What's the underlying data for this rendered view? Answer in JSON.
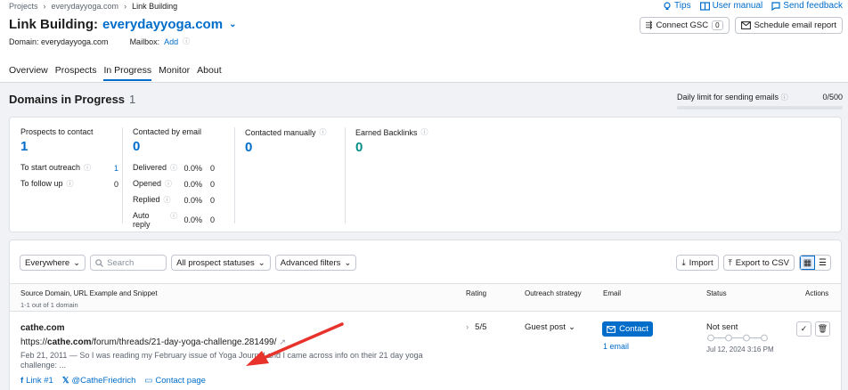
{
  "breadcrumb": {
    "items": [
      "Projects",
      "everydayyoga.com",
      "Link Building"
    ]
  },
  "header": {
    "title_prefix": "Link Building:",
    "project": "everydayyoga.com",
    "domain_label": "Domain: everydayyoga.com",
    "mailbox_label": "Mailbox:",
    "mailbox_add": "Add"
  },
  "top_links": {
    "tips": "Tips",
    "manual": "User manual",
    "feedback": "Send feedback"
  },
  "top_buttons": {
    "connect_gsc": "Connect GSC",
    "gsc_count": "0",
    "schedule": "Schedule email report"
  },
  "tabs": [
    "Overview",
    "Prospects",
    "In Progress",
    "Monitor",
    "About"
  ],
  "active_tab": "In Progress",
  "section": {
    "title": "Domains in Progress",
    "count": "1"
  },
  "daily_limit": {
    "label": "Daily limit for sending emails",
    "value": "0/500",
    "used_fraction": 0
  },
  "stats": {
    "prospects": {
      "label": "Prospects to contact",
      "value": "1",
      "rows": [
        {
          "label": "To start outreach",
          "value": "1"
        },
        {
          "label": "To follow up",
          "value": "0"
        }
      ]
    },
    "email": {
      "label": "Contacted by email",
      "value": "0",
      "rows": [
        {
          "label": "Delivered",
          "pct": "0.0%",
          "value": "0"
        },
        {
          "label": "Opened",
          "pct": "0.0%",
          "value": "0"
        },
        {
          "label": "Replied",
          "pct": "0.0%",
          "value": "0"
        },
        {
          "label": "Auto reply",
          "pct": "0.0%",
          "value": "0"
        }
      ]
    },
    "manual": {
      "label": "Contacted manually",
      "value": "0"
    },
    "backlinks": {
      "label": "Earned Backlinks",
      "value": "0"
    }
  },
  "filters": {
    "location": "Everywhere",
    "search_placeholder": "Search",
    "statuses": "All prospect statuses",
    "advanced": "Advanced filters",
    "import": "Import",
    "export": "Export to CSV"
  },
  "table": {
    "headers": {
      "source": "Source Domain, URL Example and Snippet",
      "count": "1-1 out of 1 domain",
      "rating": "Rating",
      "strategy": "Outreach strategy",
      "email": "Email",
      "status": "Status",
      "actions": "Actions"
    },
    "row": {
      "domain": "cathe.com",
      "url_prefix": "https://",
      "url_domain": "cathe.com",
      "url_path": "/forum/threads/21-day-yoga-challenge.281499/",
      "snippet": "Feb 21, 2011 — So I was reading my February issue of Yoga Journal and I came across info on their 21 day yoga challenge: ...",
      "link1": "Link #1",
      "twitter": "@CatheFriedrich",
      "contact_page": "Contact page",
      "rating": "5/5",
      "strategy": "Guest post",
      "contact_btn": "Contact",
      "emails": "1 email",
      "status": "Not sent",
      "status_date": "Jul 12, 2024 3:16 PM"
    }
  },
  "colors": {
    "accent": "#006dca",
    "teal": "#008e86",
    "annotation": "#e8322c"
  }
}
